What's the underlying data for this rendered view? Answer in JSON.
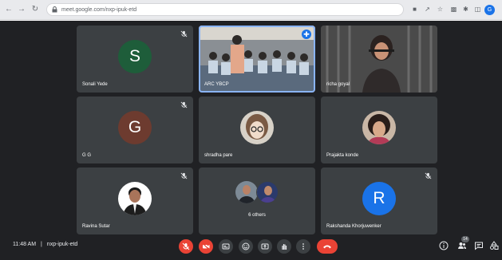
{
  "browser": {
    "url": "meet.google.com/nxp-ipuk-etd",
    "profile_initial": "G"
  },
  "participants": [
    {
      "name": "Sonali Yede",
      "avatar_letter": "S",
      "avatar_color": "#1e5d3a",
      "muted": true
    },
    {
      "name": "ARC YBCP",
      "type": "video",
      "pinned": true
    },
    {
      "name": "richa goyal",
      "type": "video"
    },
    {
      "name": "G G",
      "avatar_letter": "G",
      "avatar_color": "#6d3b2f",
      "muted": true
    },
    {
      "name": "shradha pare",
      "type": "photo"
    },
    {
      "name": "Prajakta konde",
      "type": "photo"
    },
    {
      "name": "Ravina Sutar",
      "type": "photo",
      "muted": true
    },
    {
      "name": "6 others",
      "type": "group"
    },
    {
      "name": "Rakshanda Khorjuwenker",
      "avatar_letter": "R",
      "avatar_color": "#1a73e8",
      "muted": true
    }
  ],
  "bottom_bar": {
    "time": "11:48 AM",
    "separator": "|",
    "meeting_code": "nxp-ipuk-etd",
    "people_count": "14"
  },
  "colors": {
    "background": "#202124",
    "tile": "#3c4043",
    "danger": "#ea4335",
    "accent": "#1a73e8"
  },
  "icons": {
    "mic": "mic-off-icon",
    "camera": "camera-off-icon",
    "captions": "captions-icon",
    "reactions": "emoji-icon",
    "present": "present-icon",
    "raise_hand": "hand-icon",
    "more": "more-vert-icon",
    "end_call": "end-call-icon",
    "info": "info-icon",
    "people": "people-icon",
    "chat": "chat-icon",
    "activities": "activities-icon"
  }
}
